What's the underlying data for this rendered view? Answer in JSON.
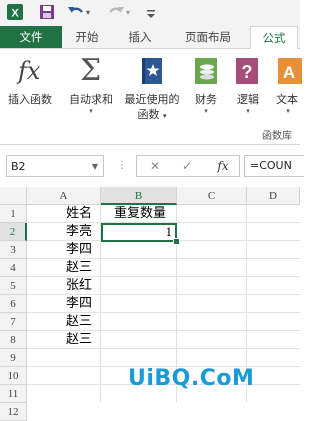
{
  "quick_access": {
    "icons": [
      "excel-icon",
      "save-icon",
      "undo-icon",
      "redo-icon",
      "customize-icon"
    ]
  },
  "tabs": [
    {
      "label": "文件"
    },
    {
      "label": "开始"
    },
    {
      "label": "插入"
    },
    {
      "label": "页面布局"
    },
    {
      "label": "公式"
    }
  ],
  "ribbon": {
    "insert_function": "插入函数",
    "autosum": "自动求和",
    "recent_line1": "最近使用的",
    "recent_line2": "函数",
    "financial": "财务",
    "logical": "逻辑",
    "text": "文本",
    "group_label": "函数库"
  },
  "formula_bar": {
    "name_box": "B2",
    "cancel": "✕",
    "enter": "✓",
    "fx": "fx",
    "formula": "=COUN"
  },
  "grid": {
    "columns": [
      "A",
      "B",
      "C",
      "D"
    ],
    "rows": [
      "1",
      "2",
      "3",
      "4",
      "5",
      "6",
      "7",
      "8",
      "9",
      "10",
      "11",
      "12"
    ],
    "cells": {
      "A1": "姓名",
      "B1": "重复数量",
      "A2": "李亮",
      "B2": "1",
      "A3": "李四",
      "A4": "赵三",
      "A5": "张红",
      "A6": "李四",
      "A7": "赵三",
      "A8": "赵三"
    }
  },
  "watermark": "UiBQ.CoM",
  "colors": {
    "accent": "#217346",
    "file_tab": "#217346",
    "watermark": "#1a9ad6"
  }
}
